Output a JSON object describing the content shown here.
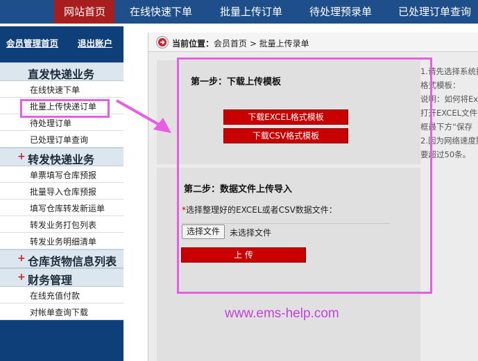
{
  "topnav": {
    "items": [
      {
        "label": "网站首页",
        "active": true
      },
      {
        "label": "在线快速下单",
        "active": false
      },
      {
        "label": "批量上传订单",
        "active": false
      },
      {
        "label": "待处理预录单",
        "active": false
      },
      {
        "label": "已处理订单查询",
        "active": false
      }
    ]
  },
  "sidebar": {
    "home_link": "会员管理首页",
    "logout_link": "退出账户",
    "sections": [
      {
        "title": "直发快递业务",
        "items": [
          "在线快速下单",
          "批量上传快递订单",
          "待处理订单",
          "已处理订单查询"
        ]
      },
      {
        "title": "转发快递业务",
        "items": [
          "单票填写仓库预报",
          "批量导入仓库预报",
          "填写仓库转发新运单",
          "转发业务打包列表",
          "转发业务明细清单"
        ]
      },
      {
        "title": "仓库货物信息列表",
        "items": []
      },
      {
        "title": "财务管理",
        "items": [
          "在线充值付款",
          "对帐单查询下载"
        ]
      }
    ]
  },
  "breadcrumb": {
    "label": "当前位置：",
    "path": "会员首页 > 批量上传录单"
  },
  "step1": {
    "title": "第一步：下载上传模板",
    "excel_button": "下载EXCEL格式模板",
    "csv_button": "下载CSV格式模板"
  },
  "step2": {
    "title": "第二步：数据文件上传导入",
    "required_mark": "*",
    "select_label": "选择整理好的EXCEL或者CSV数据文件：",
    "file_button": "选择文件",
    "file_status": "未选择文件",
    "upload_button": "上 传"
  },
  "notes": [
    "1.请先选择系统提供",
    "格式模板：",
    "说明：如何将Ex",
    "打开EXCEL文件",
    "框最下方“保存",
    "2.因为网络速度影",
    "要超过50条。"
  ],
  "watermark": "www.ems-help.com",
  "colors": {
    "nav_bg": "#1f4f8a",
    "nav_active": "#a81e1e",
    "sidebar_bg": "#0f3f78",
    "button_red": "#c80000",
    "annotation_pink": "#e65fe0"
  }
}
